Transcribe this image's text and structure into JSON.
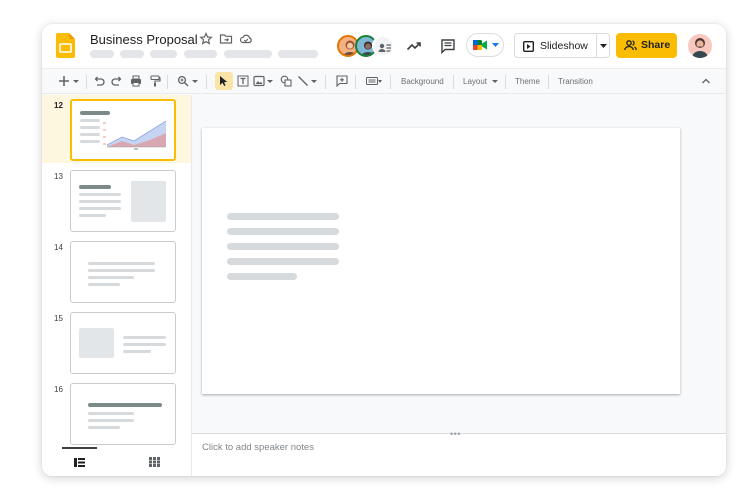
{
  "app": {
    "brand_color": "#fbbc04",
    "accent": "#1a73e8"
  },
  "header": {
    "doc_title": "Business Proposal",
    "icons": [
      "star-icon",
      "move-to-folder-icon",
      "cloud-saved-icon"
    ],
    "collaborators": [
      "avatar-1",
      "avatar-2",
      "more-collaborators"
    ],
    "slideshow_label": "Slideshow",
    "share_label": "Share"
  },
  "toolbar": {
    "background_label": "Background",
    "layout_label": "Layout",
    "theme_label": "Theme",
    "transition_label": "Transition"
  },
  "filmstrip": {
    "slides": [
      {
        "number": "12"
      },
      {
        "number": "13"
      },
      {
        "number": "14"
      },
      {
        "number": "15"
      },
      {
        "number": "16"
      }
    ],
    "active_slide": "12"
  },
  "notes": {
    "placeholder": "Click to add speaker notes"
  }
}
